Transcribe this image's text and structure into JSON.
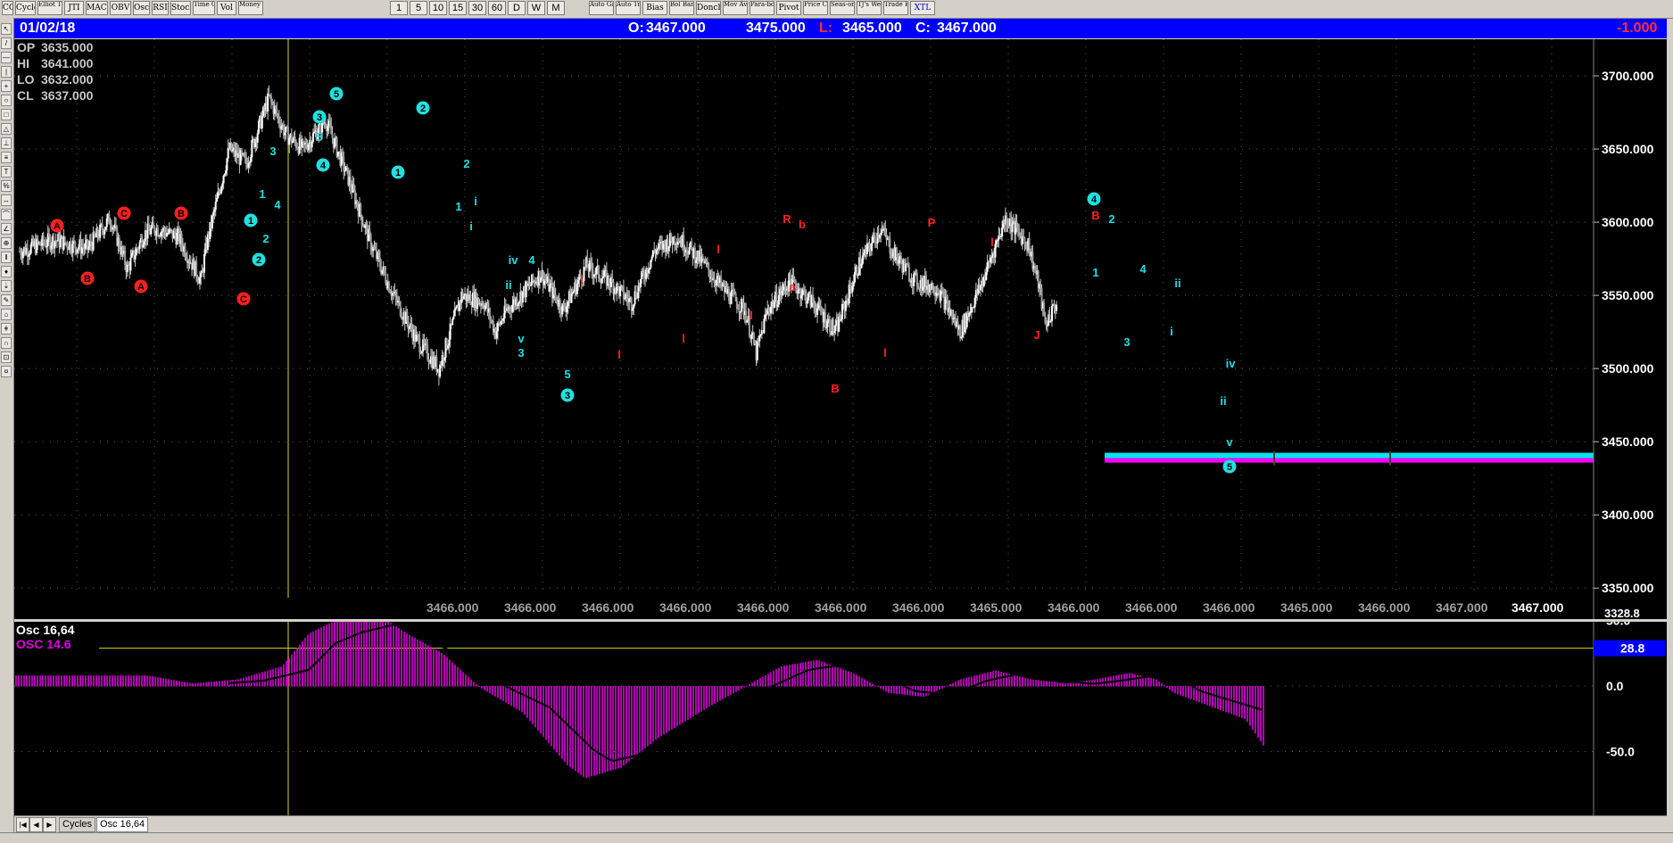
{
  "toolbar": {
    "buttons": [
      "CCI",
      "Cycles",
      "Elliot Trig",
      "JTI",
      "MACD",
      "OBV",
      "Osc",
      "RSI",
      "Stoch",
      "Time Clust",
      "Vol",
      "Money Flow"
    ],
    "timeframes": [
      "1",
      "5",
      "10",
      "15",
      "30",
      "60",
      "D",
      "W",
      "M"
    ],
    "studies": [
      "Auto Gann",
      "Auto Trend",
      "Bias",
      "Bol Band",
      "Donch",
      "Mov Ave",
      "Para-bolic",
      "Pivot",
      "Price Clust",
      "Seas-onals",
      "TJ's Web",
      "Trade Profile",
      "XTL"
    ]
  },
  "infobar": {
    "date": "01/02/18",
    "open_label": "O:",
    "open_value": "3467.000",
    "high_value": "3475.000",
    "low_label": "L:",
    "low_value": "3465.000",
    "close_label": "C:",
    "close_value": "3467.000",
    "change": "-1.000"
  },
  "ohlc_box": {
    "op_label": "OP",
    "op_value": "3635.000",
    "hi_label": "HI",
    "hi_value": "3641.000",
    "lo_label": "LO",
    "lo_value": "3632.000",
    "cl_label": "CL",
    "cl_value": "3637.000"
  },
  "main_chart": {
    "y_ticks": [
      "3700.000",
      "3650.000",
      "3600.000",
      "3550.000",
      "3500.000",
      "3450.000",
      "3400.000",
      "3350.000"
    ],
    "y_cut_label": "3328.8",
    "bottom_values": [
      "3466.000",
      "3466.000",
      "3466.000",
      "3466.000",
      "3466.000",
      "3466.000",
      "3466.000",
      "3465.000",
      "3466.000",
      "3466.000",
      "3466.000",
      "3465.000",
      "3466.000",
      "3467.000"
    ],
    "last_value": "3467.000"
  },
  "osc": {
    "title1": "Osc 16,64",
    "title2": "OSC 14.6",
    "y_ticks": [
      "50.0",
      "0.0",
      "-50.0"
    ],
    "marker_value": "28.8",
    "marker_color": "#0000ff",
    "bar_color": "#e000e0"
  },
  "tabs": [
    "Cycles",
    "Osc 16,64"
  ],
  "colors": {
    "wave_cyan": "#20e0e0",
    "wave_red": "#ff2020",
    "band_cyan": "#00e5ee",
    "band_magenta": "#ff00ff"
  },
  "chart_data": [
    {
      "type": "line",
      "description_series": "price",
      "x_index": [
        0,
        30,
        60,
        80,
        95,
        110,
        120,
        140,
        160,
        165,
        185,
        200,
        220,
        235,
        250,
        270,
        290,
        310,
        330,
        350,
        370,
        390,
        410,
        420,
        430,
        460,
        480,
        500,
        520,
        540,
        560,
        580,
        600,
        620,
        640,
        650,
        660,
        680,
        700,
        720,
        740,
        760,
        770,
        790,
        810,
        830,
        850,
        870,
        890,
        900,
        905,
        915
      ],
      "values": [
        3580,
        3588,
        3582,
        3603,
        3568,
        3592,
        3596,
        3590,
        3560,
        3585,
        3650,
        3640,
        3685,
        3660,
        3650,
        3670,
        3630,
        3585,
        3550,
        3520,
        3500,
        3550,
        3545,
        3525,
        3540,
        3565,
        3540,
        3570,
        3560,
        3545,
        3580,
        3590,
        3575,
        3555,
        3540,
        3510,
        3540,
        3560,
        3545,
        3525,
        3570,
        3596,
        3580,
        3560,
        3555,
        3525,
        3560,
        3603,
        3585,
        3555,
        3530,
        3545
      ],
      "ylim": [
        3328.8,
        3725
      ]
    },
    {
      "type": "bar",
      "description_series": "oscillator",
      "ylim": [
        -70,
        55
      ],
      "y_ticks": [
        50,
        0,
        -50
      ],
      "marker": 28.8
    }
  ]
}
